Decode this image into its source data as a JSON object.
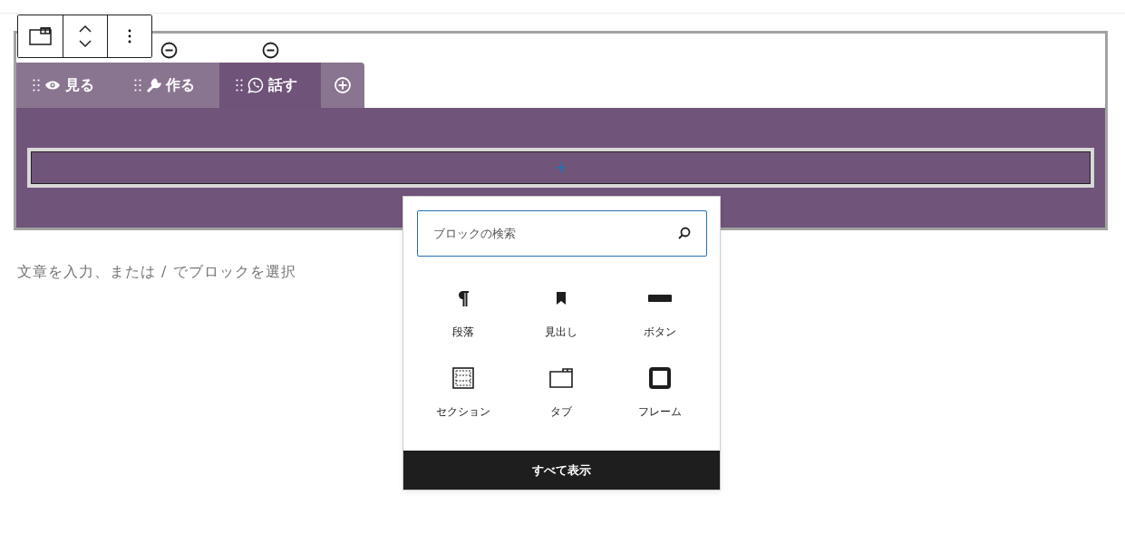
{
  "tabs": [
    {
      "label": "見る",
      "selected": false,
      "remove_icon": false
    },
    {
      "label": "作る",
      "selected": false,
      "remove_icon": true
    },
    {
      "label": "話す",
      "selected": true,
      "remove_icon": true
    }
  ],
  "paragraph_placeholder": "文章を入力、または / でブロックを選択",
  "inserter": {
    "search": {
      "placeholder": "ブロックの検索"
    },
    "blocks": [
      {
        "label": "段落"
      },
      {
        "label": "見出し"
      },
      {
        "label": "ボタン"
      },
      {
        "label": "セクション"
      },
      {
        "label": "タブ"
      },
      {
        "label": "フレーム"
      }
    ],
    "browse_all": "すべて表示"
  }
}
